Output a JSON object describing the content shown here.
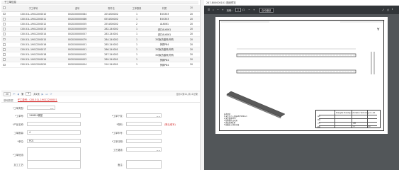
{
  "left_panel": {
    "header_title": "子工单信息",
    "columns": [
      "",
      "子工单号",
      "选号",
      "零件名",
      "工单数量",
      "材质",
      "20"
    ],
    "rows": [
      {
        "order": "C00-51L-19012200010",
        "code": "0020200000084",
        "part": "205-B00002",
        "qty": "1",
        "material": "EUS303",
        "extra": "20"
      },
      {
        "order": "C00-51L-19012200011",
        "code": "0020200000086",
        "part": "055-B00002",
        "qty": "1",
        "material": "EUS303",
        "extra": "20"
      },
      {
        "order": "C00-51L-19012200012",
        "code": "0020200000055",
        "part": "255-B00002",
        "qty": "2",
        "material": "AL6061",
        "extra": "20"
      },
      {
        "order": "C00-51L-19012200013",
        "code": "0020200000059",
        "part": "282-240002",
        "qty": "1",
        "material": "进口AL6061",
        "extra": "20"
      },
      {
        "order": "C00-51L-19012200014",
        "code": "0020200000057",
        "part": "283-240001",
        "qty": "1",
        "material": "进口AL6061",
        "extra": "20"
      },
      {
        "order": "C00-51L-19012200015",
        "code": "0020200000079",
        "part": "284-240002",
        "qty": "1",
        "material": "35钢(热镀锌)外购",
        "extra": "20"
      },
      {
        "order": "C00-51L-19012200016",
        "code": "0020200000001",
        "part": "285-240002",
        "qty": "1",
        "material": "黄铜PB4",
        "extra": "20"
      },
      {
        "order": "C00-51L-19012200017",
        "code": "0020200000001",
        "part": "286-240001",
        "qty": "1",
        "material": "35钢(热镀锌)外购",
        "extra": "20"
      },
      {
        "order": "C00-51L-19012200018",
        "code": "0020200000002",
        "part": "287-240002",
        "qty": "1",
        "material": "35钢(热镀锌)外购",
        "extra": "20"
      },
      {
        "order": "C00-51L-19012200019",
        "code": "0020200000003",
        "part": "289-240001",
        "qty": "1",
        "material": "黄铜PB4",
        "extra": "20"
      },
      {
        "order": "C00-51L-19012200020",
        "code": "0020200000004",
        "part": "210-240001",
        "qty": "1",
        "material": "黄铜PB4",
        "extra": "20"
      }
    ],
    "pager": {
      "page_size": "20",
      "page_current": "1",
      "page_total_text": "共1页",
      "info": "显示1到11,共11记录"
    },
    "tabs": {
      "tab1": "基础数据",
      "tab2": "子工单号：C00-51L-19012200001"
    },
    "form": {
      "order_type_label": "*工单类型：",
      "order_type_value": "",
      "order_no_label": "*工单号：",
      "order_no_value": "190801模型",
      "issued_label": "*工单下发：",
      "issued_value": "",
      "product_label": "*产品名称：",
      "product_value": "",
      "qty_label": "工单数量：",
      "qty_value": "4",
      "material_label": "*物料：",
      "material_value": "",
      "hint": "(默认填写)",
      "unit_label": "*单位：",
      "unit_value": "PCS",
      "date_label": "*工单日期：",
      "date_value": "",
      "line_label": "*工单班线：",
      "line_value": "",
      "process_label": "*工单车号：",
      "process_value": "",
      "route_label": "工艺路线：",
      "route_value": "",
      "requirement_label": "加工工艺：",
      "note_label": "备注："
    }
  },
  "right_panel": {
    "title_text": "247-B00000101 图纸预览",
    "pdf_toolbar": {
      "page_label": "页码：",
      "page_current": "1",
      "page_total": "/1",
      "zoom_minus": "−",
      "zoom_plus": "+",
      "fit_label": "自动缩放"
    },
    "drawing": {
      "title_block_title": "Shanghai Shendlig Automation Technology Co.,Ltd.",
      "notes_title": "技术要求",
      "notes": [
        "1.未注尺寸公差按GB/T1804-m",
        "2.未注倒角C0.5",
        "3.锐角倒钝,去毛刺",
        "4.表面发黑处理",
        "5.按图加工,检验合格"
      ],
      "tb_labels": [
        "设计",
        "审核",
        "工艺",
        "批准",
        "比例",
        "1:1",
        "A3"
      ]
    }
  }
}
